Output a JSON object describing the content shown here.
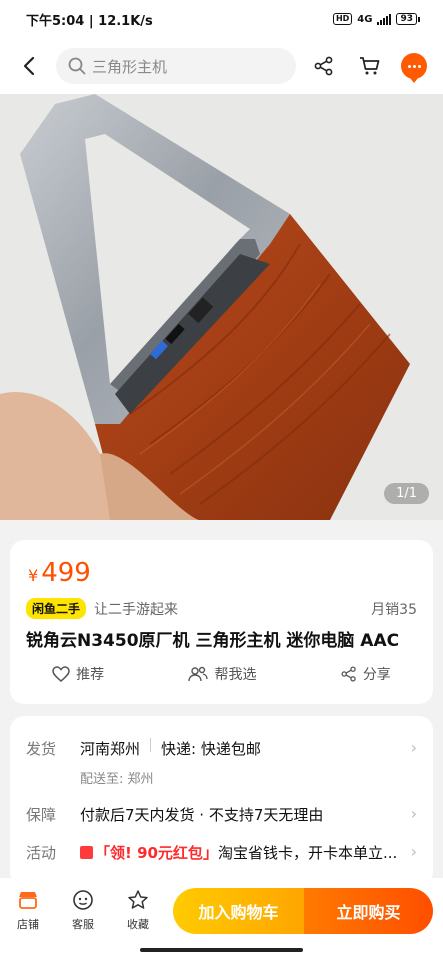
{
  "status_bar": {
    "time": "下午5:04",
    "speed": "12.1K/s",
    "hd": "HD",
    "network": "4G",
    "battery": "93"
  },
  "search": {
    "query": "三角形主机"
  },
  "gallery": {
    "counter": "1/1"
  },
  "product": {
    "currency": "¥",
    "price": "499",
    "badge": "闲鱼二手",
    "slogan": "让二手游起来",
    "monthly_sales": "月销35",
    "title": "锐角云N3450原厂机 三角形主机 迷你电脑 AAC"
  },
  "actions": {
    "recommend": "推荐",
    "help_choose": "帮我选",
    "share": "分享"
  },
  "shipping": {
    "label": "发货",
    "origin": "河南郑州",
    "express": "快递: 快递包邮",
    "deliver_to": "配送至: 郑州"
  },
  "guarantee": {
    "label": "保障",
    "text": "付款后7天内发货 · 不支持7天无理由"
  },
  "promo": {
    "label": "活动",
    "coupon": "「领! 90元红包」",
    "text": "淘宝省钱卡，开卡本单立..."
  },
  "bottom": {
    "store": "店铺",
    "service": "客服",
    "favorite": "收藏",
    "add_cart": "加入购物车",
    "buy_now": "立即购买"
  },
  "colors": {
    "accent": "#ff5000",
    "badge": "#ffe400"
  }
}
